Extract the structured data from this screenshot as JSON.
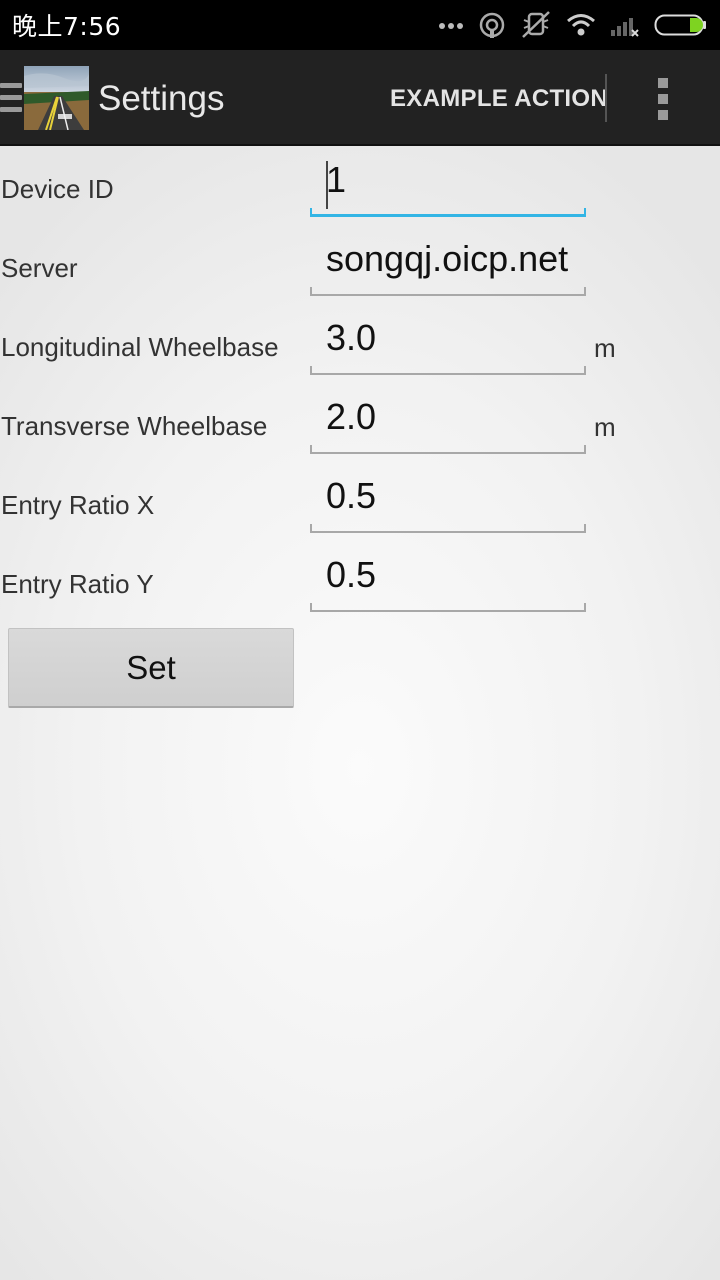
{
  "status_bar": {
    "time": "晚上7:56",
    "icons": [
      "more-dots-icon",
      "hotspot-icon",
      "silent-icon",
      "wifi-icon",
      "signal-icon",
      "battery-icon"
    ]
  },
  "action_bar": {
    "title": "Settings",
    "action_label": "EXAMPLE ACTION",
    "icons": [
      "drawer-menu-icon",
      "app-logo-road",
      "overflow-menu-icon"
    ]
  },
  "form": {
    "device_id": {
      "label": "Device ID",
      "value": "1"
    },
    "server": {
      "label": "Server",
      "value": "songqj.oicp.net"
    },
    "longitudinal_wheelbase": {
      "label": "Longitudinal Wheelbase",
      "value": "3.0",
      "unit": "m"
    },
    "transverse_wheelbase": {
      "label": "Transverse Wheelbase",
      "value": "2.0",
      "unit": "m"
    },
    "entry_ratio_x": {
      "label": "Entry Ratio X",
      "value": "0.5"
    },
    "entry_ratio_y": {
      "label": "Entry Ratio Y",
      "value": "0.5"
    },
    "set_label": "Set"
  },
  "colors": {
    "action_bar": "#222222",
    "focus_accent": "#33b5e5",
    "battery_charge": "#7ed321"
  }
}
